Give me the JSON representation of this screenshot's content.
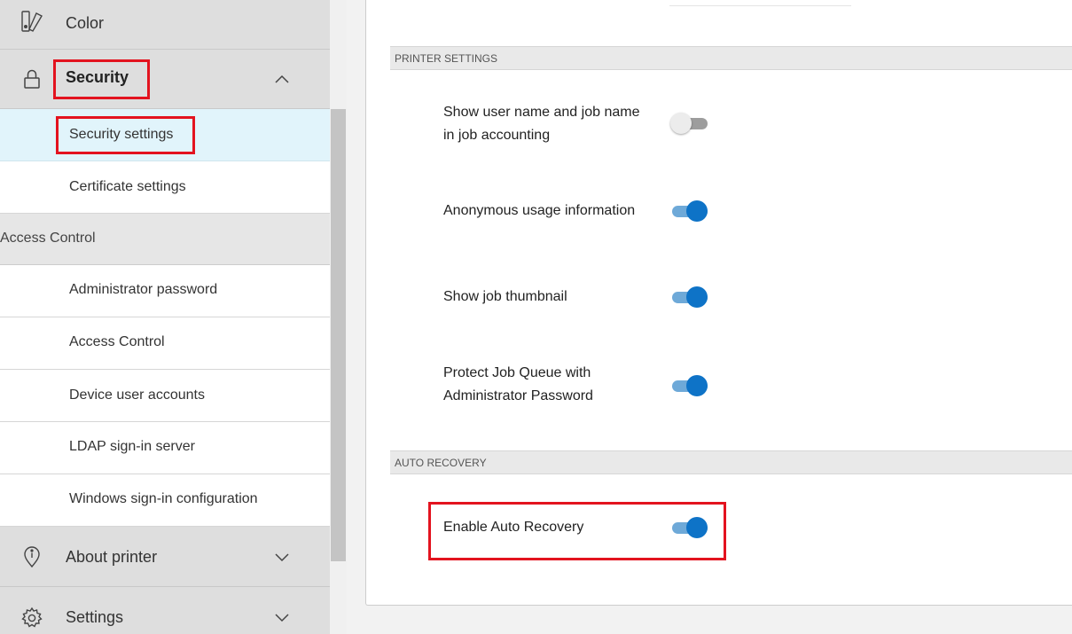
{
  "sidebar": {
    "color_label": "Color",
    "security_label": "Security",
    "security_items": [
      {
        "label": "Security settings"
      },
      {
        "label": "Certificate settings"
      }
    ],
    "access_section_label": "Access Control",
    "access_items": [
      {
        "label": "Administrator password"
      },
      {
        "label": "Access Control"
      },
      {
        "label": "Device user accounts"
      },
      {
        "label": "LDAP sign-in server"
      },
      {
        "label": "Windows sign-in configuration"
      }
    ],
    "about_label": "About printer",
    "settings_label": "Settings"
  },
  "main": {
    "printer_settings_header": "PRINTER SETTINGS",
    "printer_settings": [
      {
        "line1": "Show user name and job name",
        "line2": "in job accounting",
        "enabled": false
      },
      {
        "line1": "Anonymous usage information",
        "line2": "",
        "enabled": true
      },
      {
        "line1": "Show job thumbnail",
        "line2": "",
        "enabled": true
      },
      {
        "line1": "Protect Job Queue with",
        "line2": "Administrator Password",
        "enabled": true
      }
    ],
    "auto_recovery_header": "AUTO RECOVERY",
    "auto_recovery": {
      "label": "Enable Auto Recovery",
      "enabled": true
    }
  },
  "colors": {
    "highlight": "#e3131f",
    "toggle_on": "#0e73c7",
    "selected_row": "#e1f4fb"
  }
}
